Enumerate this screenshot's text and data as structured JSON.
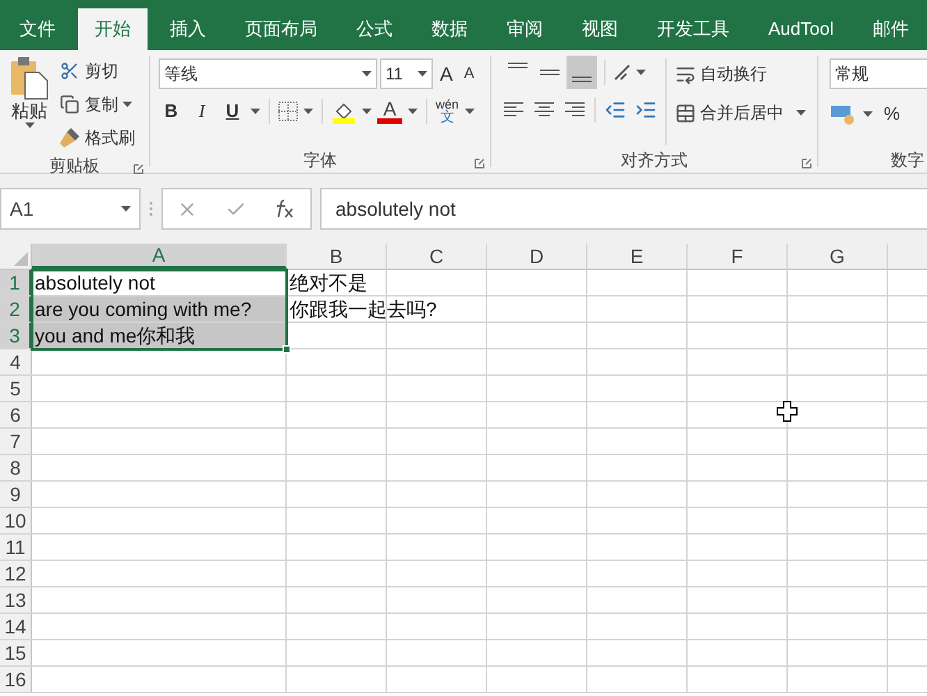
{
  "tabs": [
    {
      "label": "文件",
      "selected": false
    },
    {
      "label": "开始",
      "selected": true
    },
    {
      "label": "插入",
      "selected": false
    },
    {
      "label": "页面布局",
      "selected": false
    },
    {
      "label": "公式",
      "selected": false
    },
    {
      "label": "数据",
      "selected": false
    },
    {
      "label": "审阅",
      "selected": false
    },
    {
      "label": "视图",
      "selected": false
    },
    {
      "label": "开发工具",
      "selected": false
    },
    {
      "label": "AudTool",
      "selected": false
    },
    {
      "label": "邮件",
      "selected": false
    }
  ],
  "ribbon": {
    "clipboard": {
      "label": "剪贴板",
      "paste": "粘贴",
      "cut": "剪切",
      "copy": "复制",
      "format_painter": "格式刷"
    },
    "font": {
      "label": "字体",
      "name": "等线",
      "size": "11",
      "grow": "A",
      "shrink": "A",
      "bold": "B",
      "italic": "I",
      "underline": "U",
      "font_color": "A",
      "phonetic_top": "wén",
      "phonetic_bottom": "文"
    },
    "alignment": {
      "label": "对齐方式",
      "vertical": [
        {
          "selected": false
        },
        {
          "selected": false
        },
        {
          "selected": true
        }
      ],
      "wrap": "自动换行",
      "merge": "合并后居中"
    },
    "number": {
      "label": "数字",
      "format": "常规",
      "percent": "%"
    }
  },
  "formula_bar": {
    "name_box": "A1",
    "value": "absolutely not"
  },
  "sheet": {
    "columns": [
      {
        "label": "A",
        "selected": true
      },
      {
        "label": "B",
        "selected": false
      },
      {
        "label": "C",
        "selected": false
      },
      {
        "label": "D",
        "selected": false
      },
      {
        "label": "E",
        "selected": false
      },
      {
        "label": "F",
        "selected": false
      },
      {
        "label": "G",
        "selected": false
      }
    ],
    "rows": [
      {
        "label": "1",
        "selected": true,
        "cells": [
          {
            "text": "absolutely not",
            "highlighted": false
          },
          {
            "text": "绝对不是",
            "highlighted": false
          }
        ]
      },
      {
        "label": "2",
        "selected": true,
        "cells": [
          {
            "text": "are you coming with me?",
            "highlighted": true
          },
          {
            "text": "你跟我一起去吗?",
            "highlighted": false
          }
        ]
      },
      {
        "label": "3",
        "selected": true,
        "cells": [
          {
            "text": "you and me你和我",
            "highlighted": true
          }
        ]
      },
      {
        "label": "4",
        "selected": false,
        "cells": []
      },
      {
        "label": "5",
        "selected": false,
        "cells": []
      },
      {
        "label": "6",
        "selected": false,
        "cells": []
      },
      {
        "label": "7",
        "selected": false,
        "cells": []
      },
      {
        "label": "8",
        "selected": false,
        "cells": []
      },
      {
        "label": "9",
        "selected": false,
        "cells": []
      },
      {
        "label": "10",
        "selected": false,
        "cells": []
      },
      {
        "label": "11",
        "selected": false,
        "cells": []
      },
      {
        "label": "12",
        "selected": false,
        "cells": []
      },
      {
        "label": "13",
        "selected": false,
        "cells": []
      },
      {
        "label": "14",
        "selected": false,
        "cells": []
      },
      {
        "label": "15",
        "selected": false,
        "cells": []
      },
      {
        "label": "16",
        "selected": false,
        "cells": []
      }
    ]
  }
}
